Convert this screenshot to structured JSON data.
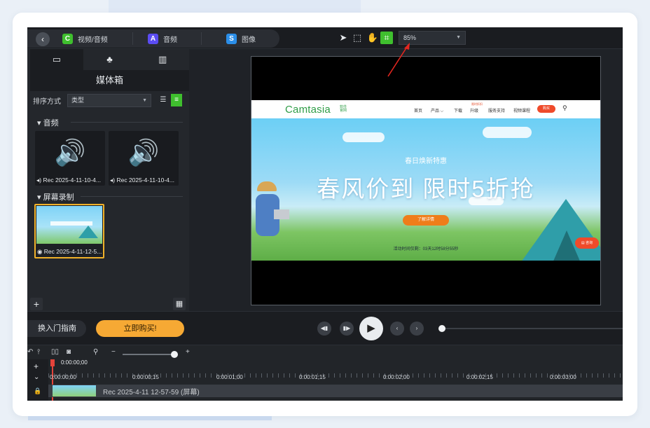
{
  "window": {
    "tabs": [
      {
        "label": "视频/音频",
        "icon": "media-icon",
        "color": "#3fbf2e"
      },
      {
        "label": "音频",
        "icon": "audio-tab-icon",
        "color": "#5b4cf2"
      },
      {
        "label": "图像",
        "icon": "image-tab-icon",
        "color": "#2b8ee8"
      }
    ],
    "tools": [
      "select-tool-icon",
      "transform-tool-icon",
      "pan-tool-icon",
      "crop-tool-icon"
    ],
    "zoom_value": "85%"
  },
  "media_bin": {
    "title": "媒体箱",
    "sort_label": "排序方式",
    "sort_value": "类型",
    "sections": [
      {
        "title": "音频",
        "items": [
          "Rec 2025-4-11-10-4...",
          "Rec 2025-4-11-10-4..."
        ]
      },
      {
        "title": "屏幕录制",
        "items": [
          "Rec 2025-4-11-12-5..."
        ]
      }
    ]
  },
  "preview": {
    "logo": "Camtasia",
    "logo_sub": "软件\n官网",
    "nav": [
      "首页",
      "产品 ⌵",
      "下载",
      "升级",
      "服务支持",
      "视频课程"
    ],
    "nav_hot": "限时折扣",
    "nav_buy": "购买",
    "hero_sub": "春日焕新特惠",
    "hero_title": "春风价到 限时5折抢",
    "hero_button": "了解详情",
    "countdown": "活动时间仅剩：03天12时58分55秒",
    "chat_button": "咨询"
  },
  "playback": {
    "guide_label": "换入门指南",
    "buy_label": "立即购买!"
  },
  "timeline": {
    "playhead_time": "0:00:00;00",
    "ticks": [
      "0:00:00;00",
      "0:00:00;15",
      "0:00:01;00",
      "0:00:01;15",
      "0:00:02;00",
      "0:00:02;15",
      "0:00:03;00"
    ],
    "clip_label": "Rec 2025-4-11 12-57-59 (屏幕)"
  }
}
